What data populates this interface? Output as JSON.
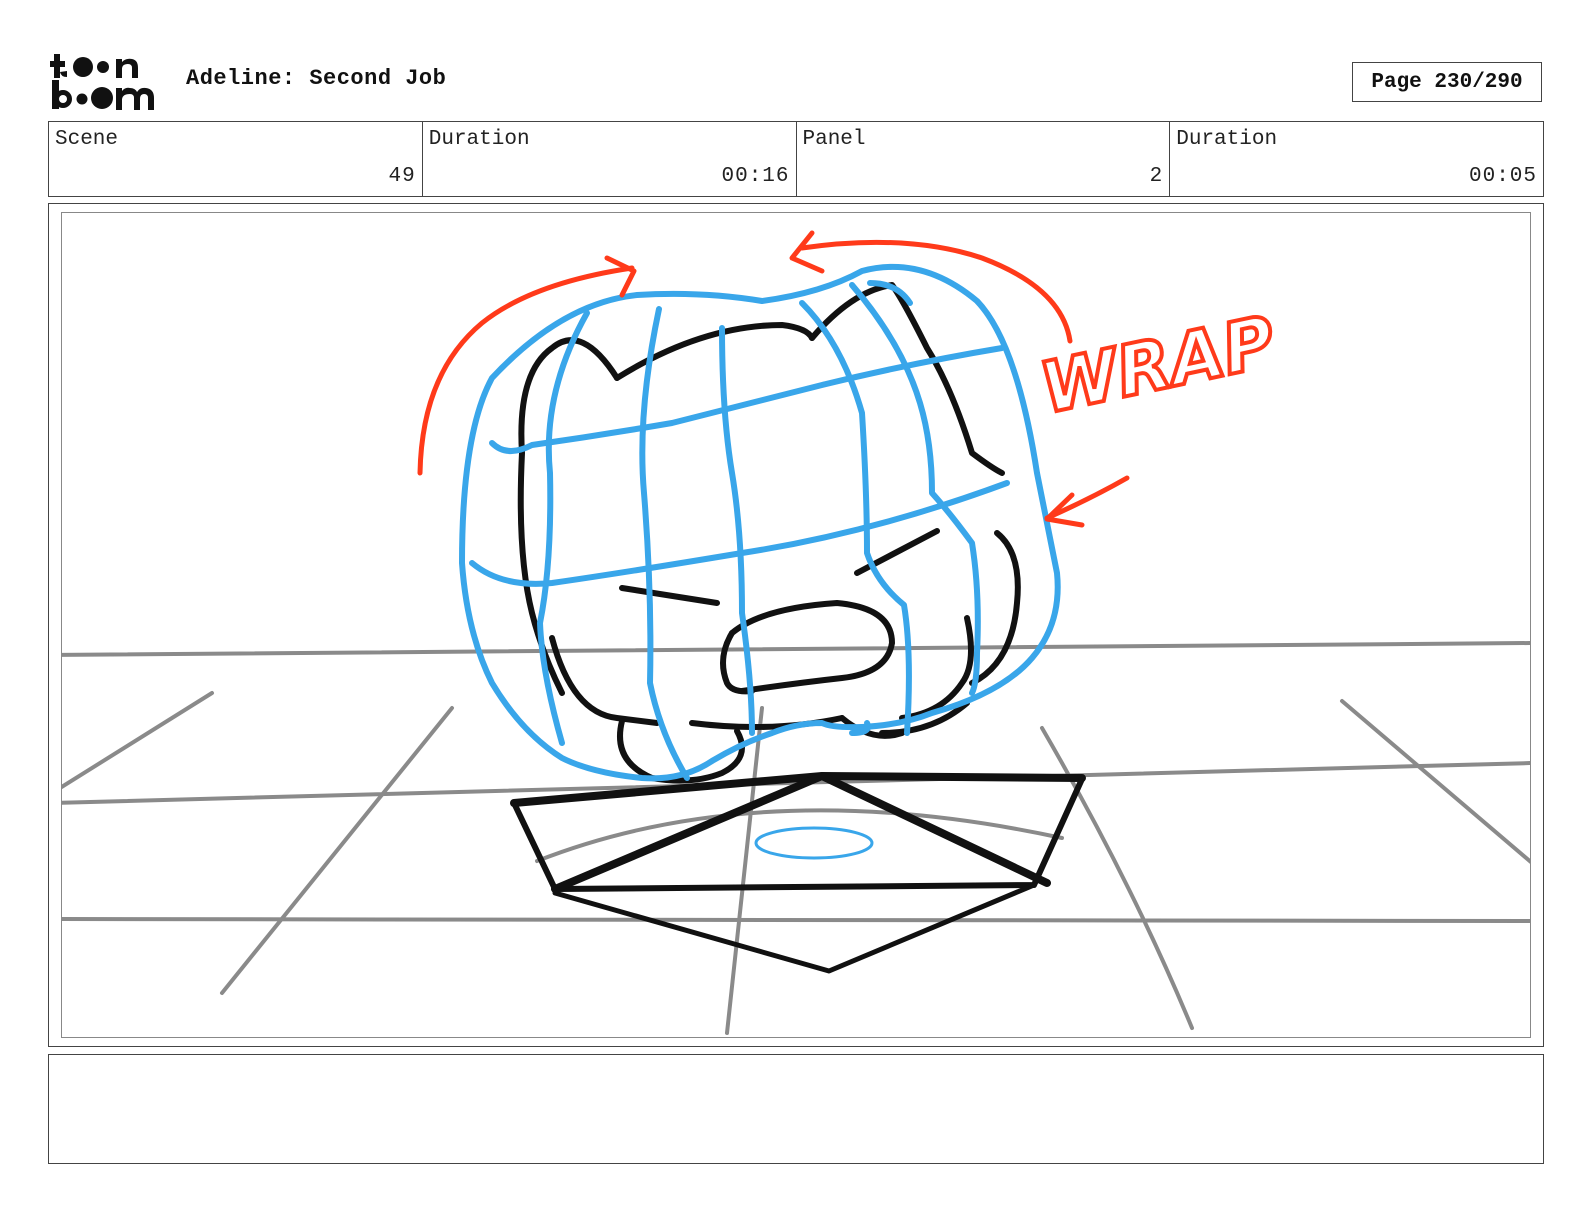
{
  "header": {
    "logo_text": "toon boom",
    "project_title": "Adeline: Second Job",
    "page_counter": "Page 230/290"
  },
  "info": {
    "scene_label": "Scene",
    "scene_value": "49",
    "scene_duration_label": "Duration",
    "scene_duration_value": "00:16",
    "panel_label": "Panel",
    "panel_value": "2",
    "panel_duration_label": "Duration",
    "panel_duration_value": "00:05"
  },
  "panel": {
    "annotation_text": "WRAP",
    "colors": {
      "floor_grid": "#8a8a8a",
      "character_lines": "#111111",
      "construction_lines": "#39a6ea",
      "annotation": "#ff3a1a"
    }
  },
  "notes": {
    "text": ""
  }
}
